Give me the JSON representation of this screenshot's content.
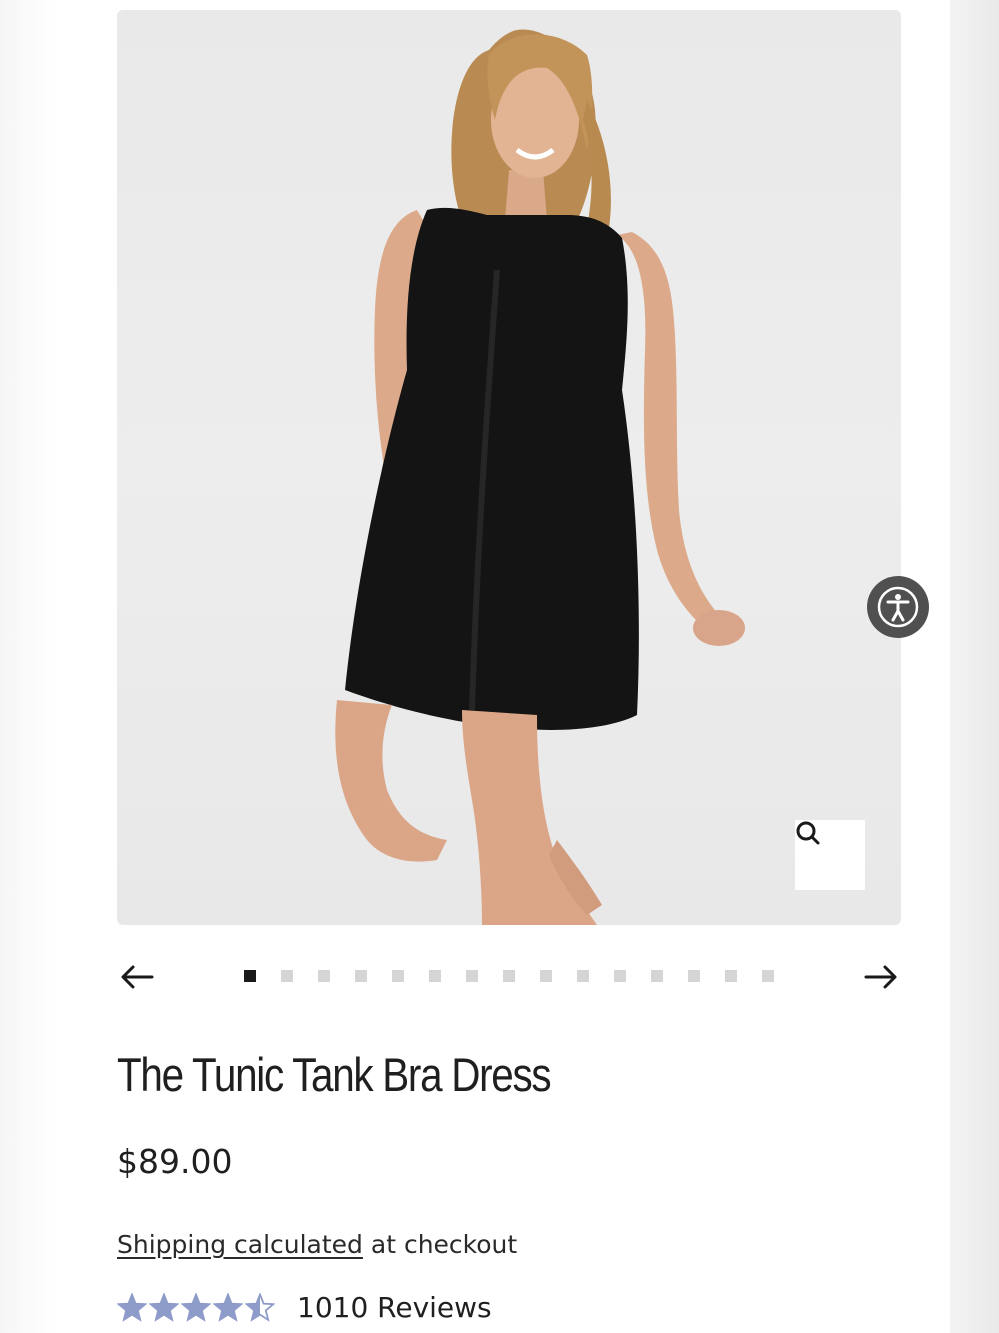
{
  "product": {
    "title": "The Tunic Tank Bra Dress",
    "price": "$89.00",
    "shipping_link": "Shipping calculated",
    "shipping_suffix": " at checkout",
    "rating_value": 4.5,
    "rating_max": 5,
    "reviews_label": "1010 Reviews",
    "image_alt": "Woman wearing a black sleeveless tunic tank dress"
  },
  "carousel": {
    "total_slides": 15,
    "active_slide": 1,
    "prev_icon": "arrow-left-icon",
    "next_icon": "arrow-right-icon"
  },
  "icons": {
    "zoom": "search-icon",
    "accessibility": "accessibility-icon",
    "star": "star-icon"
  },
  "colors": {
    "star": "#8e9cc9",
    "dress": "#141414",
    "accessibility_bg": "#505050",
    "dot_active": "#1a1a1a",
    "dot_inactive": "#d5d5d5"
  }
}
